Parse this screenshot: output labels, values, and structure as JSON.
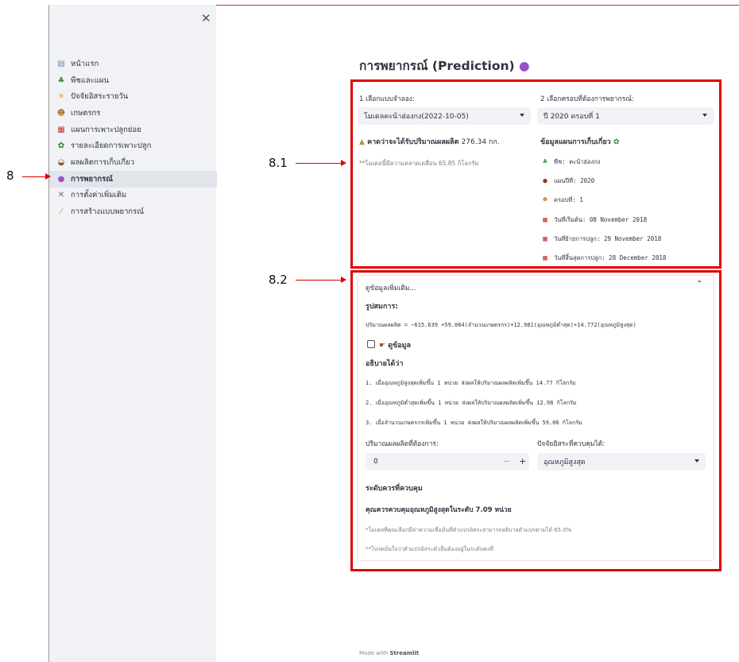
{
  "sidebar": {
    "items": [
      {
        "label": "หน้าแรก",
        "icon": "document-icon"
      },
      {
        "label": "พืชและแผน",
        "icon": "seedling-icon"
      },
      {
        "label": "ปัจจัยอิสระรายวัน",
        "icon": "weather-icon"
      },
      {
        "label": "เกษตรกร",
        "icon": "farmer-icon"
      },
      {
        "label": "แผนการเพาะปลูกย่อย",
        "icon": "calendar-icon"
      },
      {
        "label": "รายละเอียดการเพาะปลูก",
        "icon": "broccoli-icon"
      },
      {
        "label": "ผลผลิตการเก็บเกี่ยว",
        "icon": "basket-icon"
      },
      {
        "label": "การพยากรณ์",
        "icon": "crystal-ball-icon",
        "active": true
      },
      {
        "label": "การตั้งค่าเพิ่มเติม",
        "icon": "tools-icon"
      },
      {
        "label": "การสร้างแบบพยากรณ์",
        "icon": "wand-icon"
      }
    ]
  },
  "annotations": {
    "a8": "8",
    "a81": "8.1",
    "a82": "8.2"
  },
  "main": {
    "title": "การพยากรณ์ (Prediction)",
    "model_label": "1 เลือกแบบจำลอง:",
    "model_value": "โมเดลคะน้าฮ่องกง(2022-10-05)",
    "cycle_label": "2 เลือกครอบที่ต้องการพยากรณ์:",
    "cycle_value": "ปี 2020 ครอบที่ 1",
    "expected_prefix": "คาดว่าจะได้รับปริมาณผลผลิต",
    "expected_value": "276.34 กก.",
    "error_note": "**โมเดลนี้มีความคลาดเคลื่อน 65.85 กิโลกรัม",
    "harvest_title": "ข้อมูลแผนการเก็บเกี่ยว",
    "plan": [
      {
        "icon": "seedling-icon",
        "text": "พืช: คะน้าฮ่องกง"
      },
      {
        "icon": "coconut-icon",
        "text": "แผนปีที่: 2020"
      },
      {
        "icon": "farmer-icon",
        "text": "ครอบที่: 1"
      },
      {
        "icon": "calendar-icon",
        "text": "วันที่เริ่มต้น: 08 November 2018"
      },
      {
        "icon": "calendar-icon",
        "text": "วันที่ย้ายการปลูก: 29 November 2018"
      },
      {
        "icon": "calendar-icon",
        "text": "วันที่สิ้นสุดการปลูก: 28 December 2018"
      }
    ]
  },
  "expander": {
    "label": "ดูข้อมูลเพิ่มเติม...",
    "formula_title": "รูปสมการ:",
    "formula": "ปริมาณผลผลิต = −615.639 +59.064(จำนวนเกษตรกร)+12.981(อุณหภูมิต่ำสุด)+14.772(อุณหภูมิสูงสุด)",
    "checkbox_label": "ดูข้อมูล",
    "explain_title": "อธิบายได้ว่า",
    "explain": [
      "1. เมื่ออุณหภูมิสูงสุดเพิ่มขึ้น 1 หน่วย ส่งผลให้ปริมาณผลผลิตเพิ่มขึ้น 14.77 กิโลกรัม",
      "2. เมื่ออุณหภูมิต่ำสุดเพิ่มขึ้น 1 หน่วย ส่งผลให้ปริมาณผลผลิตเพิ่มขึ้น 12.98 กิโลกรัม",
      "3. เมื่อจำนวนเกษตรกรเพิ่มขึ้น 1 หน่วย ส่งผลให้ปริมาณผลผลิตเพิ่มขึ้น 59.06 กิโลกรัม"
    ],
    "target_label": "ปริมาณผลผลิตที่ต้องการ:",
    "target_value": "0",
    "minus": "−",
    "plus": "+",
    "factor_label": "ปัจจัยอิสระที่ควบคุมได้:",
    "factor_value": "อุณหภูมิสูงสุด",
    "control_title": "ระดับควรที่ควบคุม",
    "control_result": "คุณควรควบคุมอุณหภูมิสูงสุดในระดับ 7.09 หน่วย",
    "note1": "*โมเดลที่คุณเลือกมีค่าความเชื่อมั่นที่ตัวแปรอิสระสามารถอธิบายตัวแปรตามได้ 65.0%",
    "note2": "**โปรดมั่นใจว่าตัวแปรอิสระตัวอื่นต้องอยู่ในระดับคงที่"
  },
  "footer": {
    "prefix": "Made with",
    "brand": "Streamlit"
  },
  "colors": {
    "highlight": "#e00000",
    "sidebar": "#f0f2f6"
  }
}
